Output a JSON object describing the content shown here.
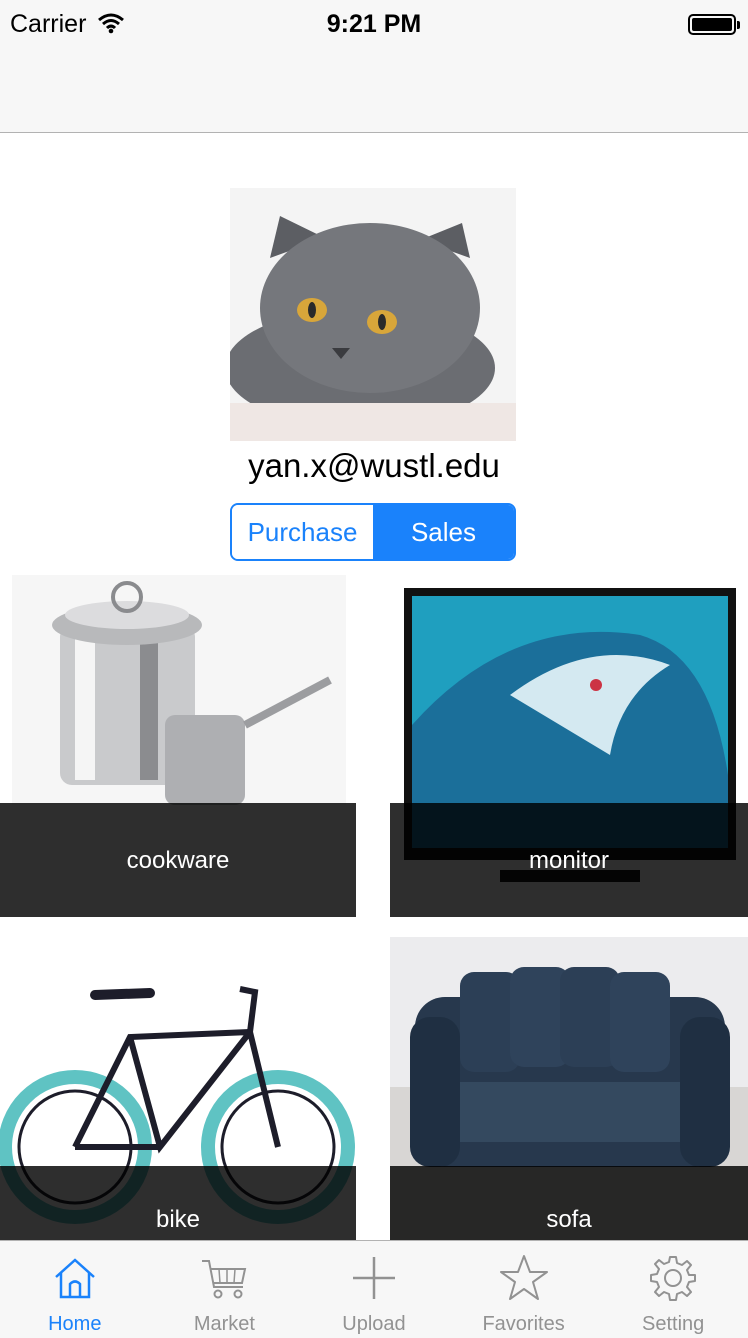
{
  "status_bar": {
    "carrier": "Carrier",
    "time": "9:21 PM"
  },
  "profile": {
    "email": "yan.x@wustl.edu"
  },
  "segment": {
    "purchase_label": "Purchase",
    "sales_label": "Sales",
    "selected": "Sales"
  },
  "items": [
    {
      "label": "cookware"
    },
    {
      "label": "monitor"
    },
    {
      "label": "bike"
    },
    {
      "label": "sofa"
    }
  ],
  "tabs": [
    {
      "label": "Home",
      "icon": "home-icon",
      "active": true
    },
    {
      "label": "Market",
      "icon": "cart-icon",
      "active": false
    },
    {
      "label": "Upload",
      "icon": "plus-icon",
      "active": false
    },
    {
      "label": "Favorites",
      "icon": "star-icon",
      "active": false
    },
    {
      "label": "Setting",
      "icon": "gear-icon",
      "active": false
    }
  ],
  "colors": {
    "accent": "#1a82fb",
    "inactive": "#929292",
    "bar_bg": "#f7f7f7"
  }
}
